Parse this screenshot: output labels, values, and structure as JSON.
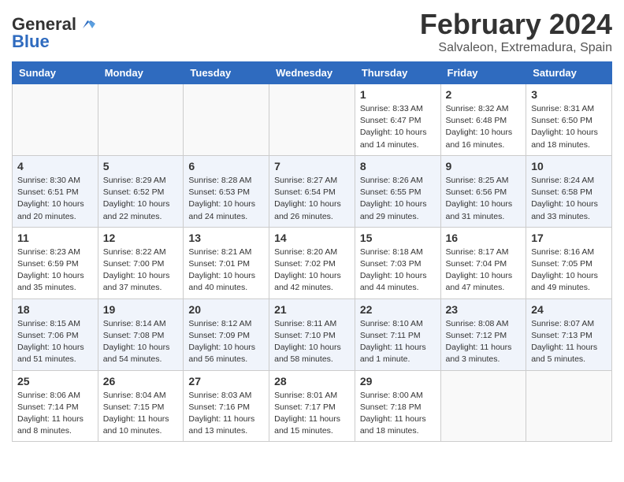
{
  "header": {
    "logo_general": "General",
    "logo_blue": "Blue",
    "month_title": "February 2024",
    "location": "Salvaleon, Extremadura, Spain"
  },
  "days_of_week": [
    "Sunday",
    "Monday",
    "Tuesday",
    "Wednesday",
    "Thursday",
    "Friday",
    "Saturday"
  ],
  "weeks": [
    [
      {
        "day": "",
        "info": ""
      },
      {
        "day": "",
        "info": ""
      },
      {
        "day": "",
        "info": ""
      },
      {
        "day": "",
        "info": ""
      },
      {
        "day": "1",
        "info": "Sunrise: 8:33 AM\nSunset: 6:47 PM\nDaylight: 10 hours and 14 minutes."
      },
      {
        "day": "2",
        "info": "Sunrise: 8:32 AM\nSunset: 6:48 PM\nDaylight: 10 hours and 16 minutes."
      },
      {
        "day": "3",
        "info": "Sunrise: 8:31 AM\nSunset: 6:50 PM\nDaylight: 10 hours and 18 minutes."
      }
    ],
    [
      {
        "day": "4",
        "info": "Sunrise: 8:30 AM\nSunset: 6:51 PM\nDaylight: 10 hours and 20 minutes."
      },
      {
        "day": "5",
        "info": "Sunrise: 8:29 AM\nSunset: 6:52 PM\nDaylight: 10 hours and 22 minutes."
      },
      {
        "day": "6",
        "info": "Sunrise: 8:28 AM\nSunset: 6:53 PM\nDaylight: 10 hours and 24 minutes."
      },
      {
        "day": "7",
        "info": "Sunrise: 8:27 AM\nSunset: 6:54 PM\nDaylight: 10 hours and 26 minutes."
      },
      {
        "day": "8",
        "info": "Sunrise: 8:26 AM\nSunset: 6:55 PM\nDaylight: 10 hours and 29 minutes."
      },
      {
        "day": "9",
        "info": "Sunrise: 8:25 AM\nSunset: 6:56 PM\nDaylight: 10 hours and 31 minutes."
      },
      {
        "day": "10",
        "info": "Sunrise: 8:24 AM\nSunset: 6:58 PM\nDaylight: 10 hours and 33 minutes."
      }
    ],
    [
      {
        "day": "11",
        "info": "Sunrise: 8:23 AM\nSunset: 6:59 PM\nDaylight: 10 hours and 35 minutes."
      },
      {
        "day": "12",
        "info": "Sunrise: 8:22 AM\nSunset: 7:00 PM\nDaylight: 10 hours and 37 minutes."
      },
      {
        "day": "13",
        "info": "Sunrise: 8:21 AM\nSunset: 7:01 PM\nDaylight: 10 hours and 40 minutes."
      },
      {
        "day": "14",
        "info": "Sunrise: 8:20 AM\nSunset: 7:02 PM\nDaylight: 10 hours and 42 minutes."
      },
      {
        "day": "15",
        "info": "Sunrise: 8:18 AM\nSunset: 7:03 PM\nDaylight: 10 hours and 44 minutes."
      },
      {
        "day": "16",
        "info": "Sunrise: 8:17 AM\nSunset: 7:04 PM\nDaylight: 10 hours and 47 minutes."
      },
      {
        "day": "17",
        "info": "Sunrise: 8:16 AM\nSunset: 7:05 PM\nDaylight: 10 hours and 49 minutes."
      }
    ],
    [
      {
        "day": "18",
        "info": "Sunrise: 8:15 AM\nSunset: 7:06 PM\nDaylight: 10 hours and 51 minutes."
      },
      {
        "day": "19",
        "info": "Sunrise: 8:14 AM\nSunset: 7:08 PM\nDaylight: 10 hours and 54 minutes."
      },
      {
        "day": "20",
        "info": "Sunrise: 8:12 AM\nSunset: 7:09 PM\nDaylight: 10 hours and 56 minutes."
      },
      {
        "day": "21",
        "info": "Sunrise: 8:11 AM\nSunset: 7:10 PM\nDaylight: 10 hours and 58 minutes."
      },
      {
        "day": "22",
        "info": "Sunrise: 8:10 AM\nSunset: 7:11 PM\nDaylight: 11 hours and 1 minute."
      },
      {
        "day": "23",
        "info": "Sunrise: 8:08 AM\nSunset: 7:12 PM\nDaylight: 11 hours and 3 minutes."
      },
      {
        "day": "24",
        "info": "Sunrise: 8:07 AM\nSunset: 7:13 PM\nDaylight: 11 hours and 5 minutes."
      }
    ],
    [
      {
        "day": "25",
        "info": "Sunrise: 8:06 AM\nSunset: 7:14 PM\nDaylight: 11 hours and 8 minutes."
      },
      {
        "day": "26",
        "info": "Sunrise: 8:04 AM\nSunset: 7:15 PM\nDaylight: 11 hours and 10 minutes."
      },
      {
        "day": "27",
        "info": "Sunrise: 8:03 AM\nSunset: 7:16 PM\nDaylight: 11 hours and 13 minutes."
      },
      {
        "day": "28",
        "info": "Sunrise: 8:01 AM\nSunset: 7:17 PM\nDaylight: 11 hours and 15 minutes."
      },
      {
        "day": "29",
        "info": "Sunrise: 8:00 AM\nSunset: 7:18 PM\nDaylight: 11 hours and 18 minutes."
      },
      {
        "day": "",
        "info": ""
      },
      {
        "day": "",
        "info": ""
      }
    ]
  ]
}
